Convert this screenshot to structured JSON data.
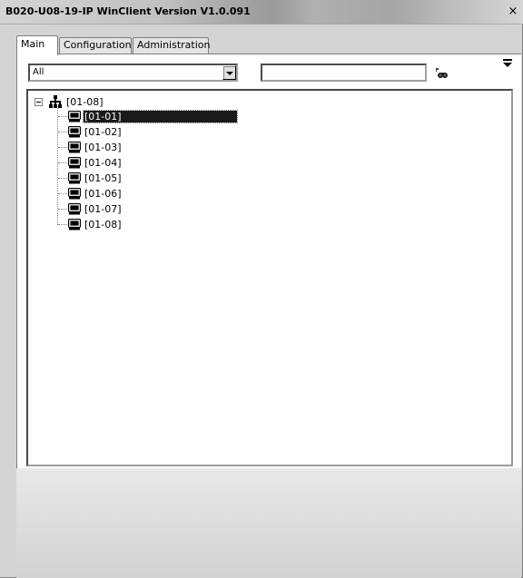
{
  "window": {
    "title": "B020-U08-19-IP WinClient Version V1.0.091",
    "close_glyph": "×"
  },
  "tabs": [
    {
      "label": "Main",
      "active": true
    },
    {
      "label": "Configuration",
      "active": false
    },
    {
      "label": "Administration",
      "active": false
    }
  ],
  "filter": {
    "selected": "All"
  },
  "search": {
    "value": "",
    "placeholder": ""
  },
  "icons": {
    "search": "binoculars-icon",
    "menu": "menu-arrow-icon",
    "root": "network-tree-icon",
    "node": "computer-icon"
  },
  "tree": {
    "root": {
      "label": "[01-08]",
      "expanded": true
    },
    "children": [
      {
        "label": "[01-01]",
        "selected": true
      },
      {
        "label": "[01-02]",
        "selected": false
      },
      {
        "label": "[01-03]",
        "selected": false
      },
      {
        "label": "[01-04]",
        "selected": false
      },
      {
        "label": "[01-05]",
        "selected": false
      },
      {
        "label": "[01-06]",
        "selected": false
      },
      {
        "label": "[01-07]",
        "selected": false
      },
      {
        "label": "[01-08]",
        "selected": false
      }
    ]
  }
}
